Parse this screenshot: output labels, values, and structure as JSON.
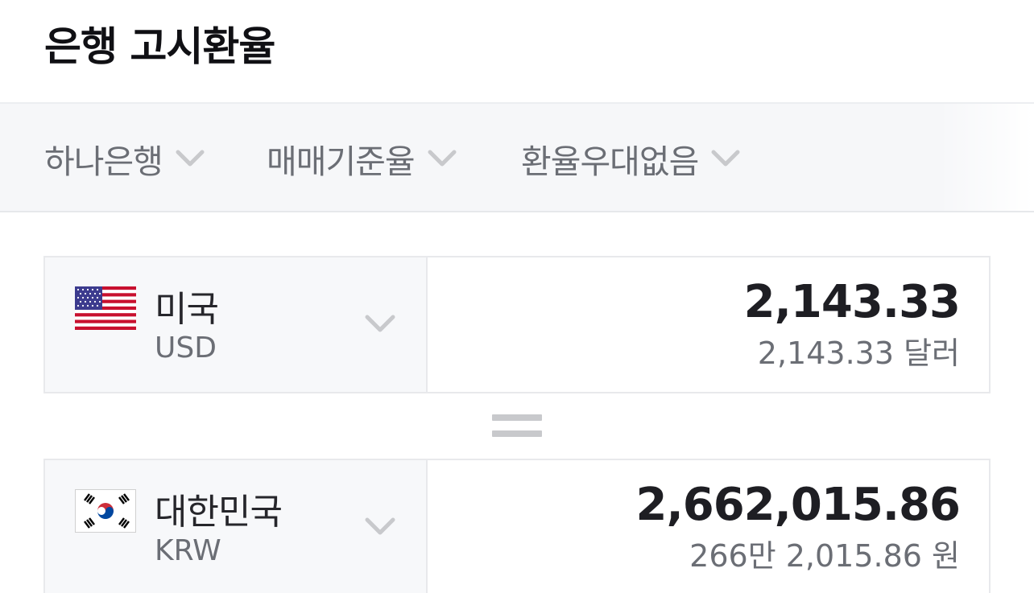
{
  "header": {
    "title": "은행 고시환율"
  },
  "filters": [
    {
      "label": "하나은행",
      "icon": "chevron-down-icon"
    },
    {
      "label": "매매기준율",
      "icon": "chevron-down-icon"
    },
    {
      "label": "환율우대없음",
      "icon": "chevron-down-icon"
    }
  ],
  "from_currency": {
    "flag": "us-flag-icon",
    "name": "미국",
    "code": "USD",
    "amount": "2,143.33",
    "amount_text": "2,143.33 달러"
  },
  "equals_icon": "equals-icon",
  "to_currency": {
    "flag": "kr-flag-icon",
    "name": "대한민국",
    "code": "KRW",
    "amount": "2,662,015.86",
    "amount_text": "266만 2,015.86 원"
  },
  "colors": {
    "text_primary": "#1e1e23",
    "text_secondary": "#6b6e75",
    "filter_bg": "#f6f7f9",
    "border": "#e8e9ec",
    "icon_gray": "#c8c9cc"
  }
}
